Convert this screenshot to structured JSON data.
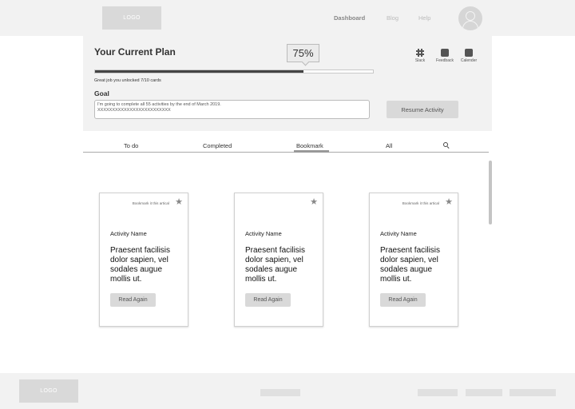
{
  "header": {
    "logo": "LOGO",
    "nav": [
      {
        "label": "Dashboard",
        "active": true
      },
      {
        "label": "Blog",
        "active": false
      },
      {
        "label": "Help",
        "active": false
      }
    ],
    "avatar_icon": "user-avatar-icon"
  },
  "plan": {
    "title": "Your Current Plan",
    "progress_label": "75%",
    "progress_value": 0.75,
    "unlocked_text": "Great job you unlocked 7/10 cards",
    "goal_label": "Goal",
    "goal_line1": "I'm going to complete all 55 activities by the end of March 2019.",
    "goal_line2": "XXXXXXXXXXXXXXXXXXXXXXXXX",
    "resume_label": "Resume Activity",
    "integrations": [
      {
        "label": "Slack",
        "icon": "slack-icon"
      },
      {
        "label": "Feedback",
        "icon": "feedback-icon"
      },
      {
        "label": "Calender",
        "icon": "calendar-icon"
      }
    ]
  },
  "tabs": [
    {
      "label": "To do"
    },
    {
      "label": "Completed"
    },
    {
      "label": "Bookmark",
      "active": true
    },
    {
      "label": "All"
    }
  ],
  "search_icon": "search-icon",
  "cards": [
    {
      "bookmark_text": "Bookmark it this artical",
      "name": "Activity Name",
      "desc": "Praesent facilisis dolor sapien, vel sodales augue mollis ut.",
      "button": "Read Again"
    },
    {
      "bookmark_text": "",
      "name": "Activity Name",
      "desc": "Praesent facilisis dolor sapien, vel sodales augue mollis ut.",
      "button": "Read Again"
    },
    {
      "bookmark_text": "Bookmark it this artical",
      "name": "Activity Name",
      "desc": "Praesent facilisis dolor sapien, vel sodales augue mollis ut.",
      "button": "Read Again"
    }
  ],
  "footer": {
    "logo": "LOGO"
  },
  "colors": {
    "panel_bg": "#f2f2f2",
    "progress_fill": "#444444",
    "button_bg": "#d9d9d9"
  }
}
